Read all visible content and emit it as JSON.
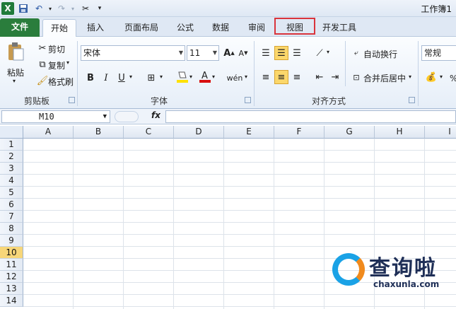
{
  "window": {
    "title": "工作簿1"
  },
  "tabs": [
    {
      "label": "文件"
    },
    {
      "label": "开始"
    },
    {
      "label": "插入"
    },
    {
      "label": "页面布局"
    },
    {
      "label": "公式"
    },
    {
      "label": "数据"
    },
    {
      "label": "审阅"
    },
    {
      "label": "视图"
    },
    {
      "label": "开发工具"
    }
  ],
  "ribbon": {
    "clipboard": {
      "paste": "粘贴",
      "cut": "剪切",
      "copy": "复制",
      "format_painter": "格式刷",
      "group": "剪贴板"
    },
    "font": {
      "name": "宋体",
      "size": "11",
      "group": "字体"
    },
    "alignment": {
      "wrap": "自动换行",
      "merge": "合并后居中",
      "group": "对齐方式"
    },
    "number": {
      "format": "常规"
    }
  },
  "formula_bar": {
    "name_box": "M10",
    "fx": "fx",
    "content": ""
  },
  "grid": {
    "columns": [
      "A",
      "B",
      "C",
      "D",
      "E",
      "F",
      "G",
      "H",
      "I"
    ],
    "rows": [
      "1",
      "2",
      "3",
      "4",
      "5",
      "6",
      "7",
      "8",
      "9",
      "10",
      "11",
      "12",
      "13",
      "14"
    ],
    "active_row": "10"
  },
  "watermark": {
    "brand": "查询啦",
    "domain": "chaxunla.com"
  },
  "colors": {
    "file_tab": "#2a7d3c",
    "highlight": "#d9343c",
    "active_header": "#f7d679"
  },
  "icons": [
    "excel-icon",
    "save-icon",
    "undo-icon",
    "redo-icon",
    "customize-icon",
    "paste-icon",
    "cut-icon",
    "copy-icon",
    "format-painter-icon",
    "bold-icon",
    "italic-icon",
    "underline-icon",
    "border-icon",
    "fill-color-icon",
    "font-color-icon",
    "align-top-icon",
    "align-middle-icon",
    "align-bottom-icon",
    "orientation-icon",
    "align-left-icon",
    "align-center-icon",
    "align-right-icon",
    "indent-decrease-icon",
    "indent-increase-icon",
    "wrap-text-icon",
    "merge-center-icon",
    "currency-icon"
  ]
}
